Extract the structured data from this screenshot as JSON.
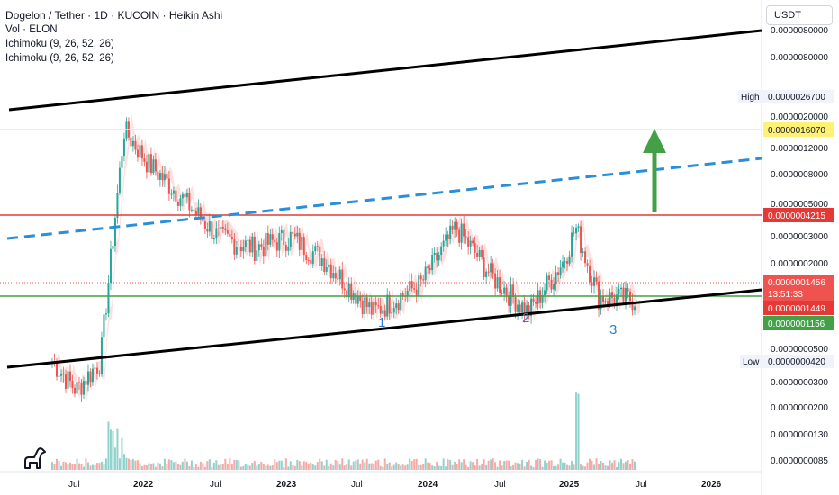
{
  "header": {
    "title": "Dogelon / Tether · 1D · KUCOIN · Heikin Ashi",
    "indicator_vol": "Vol · ELON",
    "indicator_ichimoku_1": "Ichimoku (9, 26, 52, 26)",
    "indicator_ichimoku_2": "Ichimoku (9, 26, 52, 26)"
  },
  "currency_button": "USDT",
  "colors": {
    "bull": "#26a69a",
    "bear": "#ef5350",
    "channel": "#000000",
    "dashed_trend": "#2a8fd8",
    "resistance": "#e53935",
    "support": "#43a047",
    "target": "#fff176",
    "arrow": "#43a047"
  },
  "chart_data": {
    "type": "candlestick",
    "scale": "log",
    "price_axis_ticks": [
      "0.0000080000",
      "0.0000050000",
      "0.0000020000",
      "0.0000012000",
      "0.0000008000",
      "0.0000005000",
      "0.0000003000",
      "0.0000002000",
      "0.0000000500",
      "0.0000000300",
      "0.0000000200",
      "0.0000000130",
      "0.0000000085"
    ],
    "time_axis_ticks": [
      "Jul",
      "2022",
      "Jul",
      "2023",
      "Jul",
      "2024",
      "Jul",
      "2025",
      "Jul",
      "2026"
    ],
    "price_tags": [
      {
        "label": "High",
        "value": "0.0000026700",
        "style": "plain"
      },
      {
        "label": "",
        "value": "0.0000016070",
        "style": "yellow"
      },
      {
        "label": "",
        "value": "0.0000004215",
        "style": "red"
      },
      {
        "label": "",
        "value": "0.0000001456",
        "style": "red"
      },
      {
        "label": "",
        "value": "13:51:33",
        "style": "red"
      },
      {
        "label": "",
        "value": "0.0000001449",
        "style": "red"
      },
      {
        "label": "",
        "value": "0.0000001156",
        "style": "green"
      },
      {
        "label": "Low",
        "value": "0.0000000420",
        "style": "plain"
      }
    ],
    "wave_labels": [
      "1",
      "2",
      "3"
    ],
    "price_path_approx": [
      {
        "date": "2021-05",
        "close": 6e-08
      },
      {
        "date": "2021-07",
        "close": 4e-08
      },
      {
        "date": "2021-09",
        "close": 6e-08
      },
      {
        "date": "2021-11",
        "close": 1.6e-06
      },
      {
        "date": "2022-01",
        "close": 1e-06
      },
      {
        "date": "2022-04",
        "close": 6e-07
      },
      {
        "date": "2022-07",
        "close": 3.5e-07
      },
      {
        "date": "2022-10",
        "close": 3e-07
      },
      {
        "date": "2023-01",
        "close": 3.5e-07
      },
      {
        "date": "2023-04",
        "close": 2.5e-07
      },
      {
        "date": "2023-08",
        "close": 1.2e-07
      },
      {
        "date": "2023-12",
        "close": 1.8e-07
      },
      {
        "date": "2024-03",
        "close": 4e-07
      },
      {
        "date": "2024-06",
        "close": 2e-07
      },
      {
        "date": "2024-09",
        "close": 1.2e-07
      },
      {
        "date": "2024-12",
        "close": 2.5e-07
      },
      {
        "date": "2025-01",
        "close": 4e-07
      },
      {
        "date": "2025-03",
        "close": 1.5e-07
      },
      {
        "date": "2025-06",
        "close": 1.45e-07
      }
    ],
    "ylim": [
      3e-08,
      1e-05
    ]
  }
}
